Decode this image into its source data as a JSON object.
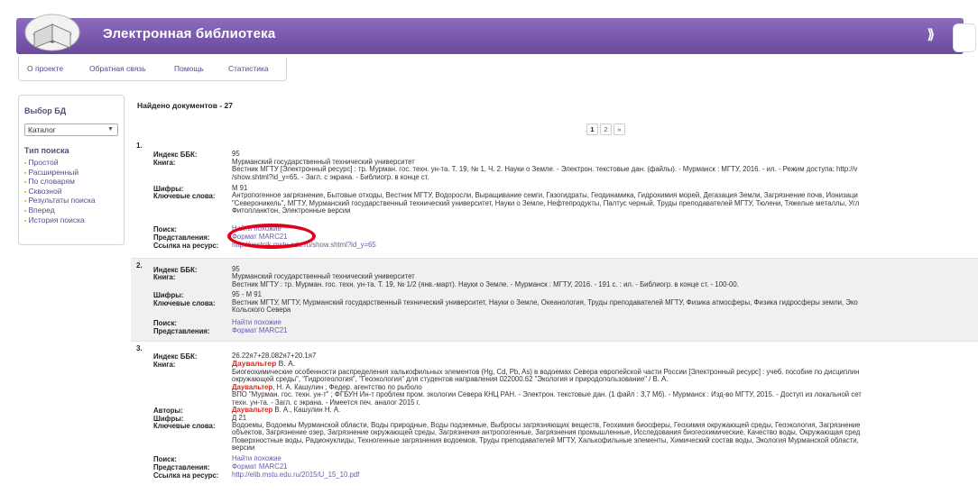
{
  "header": {
    "title": "Электронная библиотека",
    "exit_glyph": "⟫"
  },
  "tabs": [
    "О проекте",
    "Обратная связь",
    "Помощь",
    "Статистика"
  ],
  "sidebar": {
    "db_title": "Выбор БД",
    "db_selected": "Каталог",
    "search_type_title": "Тип поиска",
    "search_types": [
      "Простой",
      "Расширенный",
      "По словарям",
      "Сквозной",
      "Результаты поиска",
      "Вперед",
      "История поиска"
    ]
  },
  "results": {
    "found_text": "Найдено документов - 27",
    "pages": [
      "1",
      "2",
      "»"
    ],
    "records": [
      {
        "num": "1.",
        "bbk_label": "Индекс ББК:",
        "bbk": "95",
        "book_label": "Книга:",
        "book": [
          "Мурманский государственный технический университет",
          "Вестник МГТУ [Электронный ресурс] : тр. Мурман. гос. техн. ун-та. Т. 19, № 1, Ч. 2. Науки о Земле. - Электрон. текстовые дан. (файлы). - Мурманск : МГТУ, 2016. - ил. - Режим доступа: http://v",
          "/show.shtml?id_y=65. - Загл. с экрана. - Библиогр. в конце ст."
        ],
        "codes_label": "Шифры:",
        "codes": "М 91",
        "keywords_label": "Ключевые слова:",
        "keywords": [
          "Антропогенное загрязнение, Бытовые отходы, Вестник МГТУ, Водоросли, Выращивание семги, Газогидраты, Геодинамика, Гидрохимия морей, Дегазация Земли, Загрязнение почв, Ионизаци",
          "\"Североникель\", МГТУ, Мурманский государственный технический университет, Науки о Земле, Нефтепродукты, Палтус черный, Труды преподавателей МГТУ, Тюлени, Тяжелые металлы, Угл",
          "Фитопланктон, Электронные версии"
        ],
        "search_label": "Поиск:",
        "search_link": "Найти похожие",
        "view_label": "Представления:",
        "view_link": "Формат MARC21",
        "link_label": "Ссылка на ресурс:",
        "link": "http://vestnik.mstu.edu.ru/show.shtml?id_y=65"
      },
      {
        "num": "2.",
        "bbk_label": "Индекс ББК:",
        "bbk": "95",
        "book_label": "Книга:",
        "book": [
          "Мурманский государственный технический университет",
          "Вестник МГТУ : тр. Мурман. гос. техн. ун-та. Т. 19, № 1/2 (янв.-март). Науки о Земле. - Мурманск : МГТУ, 2016. - 191 с. : ил. - Библиогр. в конце ст. - 100-00."
        ],
        "codes_label": "Шифры:",
        "codes": "95 - М 91",
        "keywords_label": "Ключевые слова:",
        "keywords": [
          "Вестник МГТУ, МГТУ, Мурманский государственный технический университет, Науки о Земле, Океанология, Труды преподавателей МГТУ, Физика атмосферы, Физика гидросферы земли, Эко",
          "Кольского Севера"
        ],
        "search_label": "Поиск:",
        "search_link": "Найти похожие",
        "view_label": "Представления:",
        "view_link": "Формат MARC21"
      },
      {
        "num": "3.",
        "bbk_label": "Индекс ББК:",
        "bbk": "26.22я7+28.082я7+20.1я7",
        "book_label": "Книга:",
        "author_head": "Даувальтер",
        "author_tail": " В. А.",
        "book": [
          "Биогеохимические особенности распределения халькофильных элементов (Hg, Cd, Pb, As) в водоемах Севера европейской части России [Электронный ресурс] : учеб. пособие по дисциплин",
          "окружающей среды\", \"Гидрогеология\", \"Геоэкология\" для студентов направления 022000.62 \"Экология и природопользование\" / В. А."
        ],
        "book_line3_author": "Даувальтер",
        "book_line3_tail": ", Н. А. Кашулин ; Федер. агентство по рыболо",
        "book_more": [
          "ВПО \"Мурман. гос. техн. ун-т\" ; ФГБУН Ин-т проблем пром. экологии Севера КНЦ РАН. - Электрон. текстовые дан. (1 файл : 3,7 Мб). - Мурманск : Изд-во МГТУ, 2015. - Доступ из локальной сет",
          "техн. ун-та. - Загл. с экрана. - Имеется печ. аналог 2015 г."
        ],
        "authors_label": "Авторы:",
        "authors_head": "Даувальтер",
        "authors_tail": " В. А., Кашулин Н. А.",
        "codes_label": "Шифры:",
        "codes": "Д 21",
        "keywords_label": "Ключевые слова:",
        "keywords": [
          "Водоемы, Водоемы Мурманской области, Воды природные, Воды подземные, Выбросы загрязняющих веществ, Геохимия биосферы, Геохимия окружающей среды, Геоэкология, Загрязнение",
          "объектов, Загрязнение озер, Загрязнение окружающей среды, Загрязнения антропогенные, Загрязнения промышленные, Исследования биогеохимические, Качество воды, Окружающая сред",
          "Поверхностные воды, Радионуклиды, Техногенные загрязнения водоемов, Труды преподавателей МГТУ, Халькофильные элементы, Химический состав воды, Экология Мурманской области,",
          "версии"
        ],
        "search_label": "Поиск:",
        "search_link": "Найти похожие",
        "view_label": "Представления:",
        "view_link": "Формат MARC21",
        "link_label": "Ссылка на ресурс:",
        "link": "http://elib.mstu.edu.ru/2015/U_15_10.pdf"
      }
    ]
  },
  "colors": {
    "header": "#7656aa",
    "link": "#6b5aa5",
    "author": "#d42a1e",
    "highlight": "#e0001b"
  }
}
